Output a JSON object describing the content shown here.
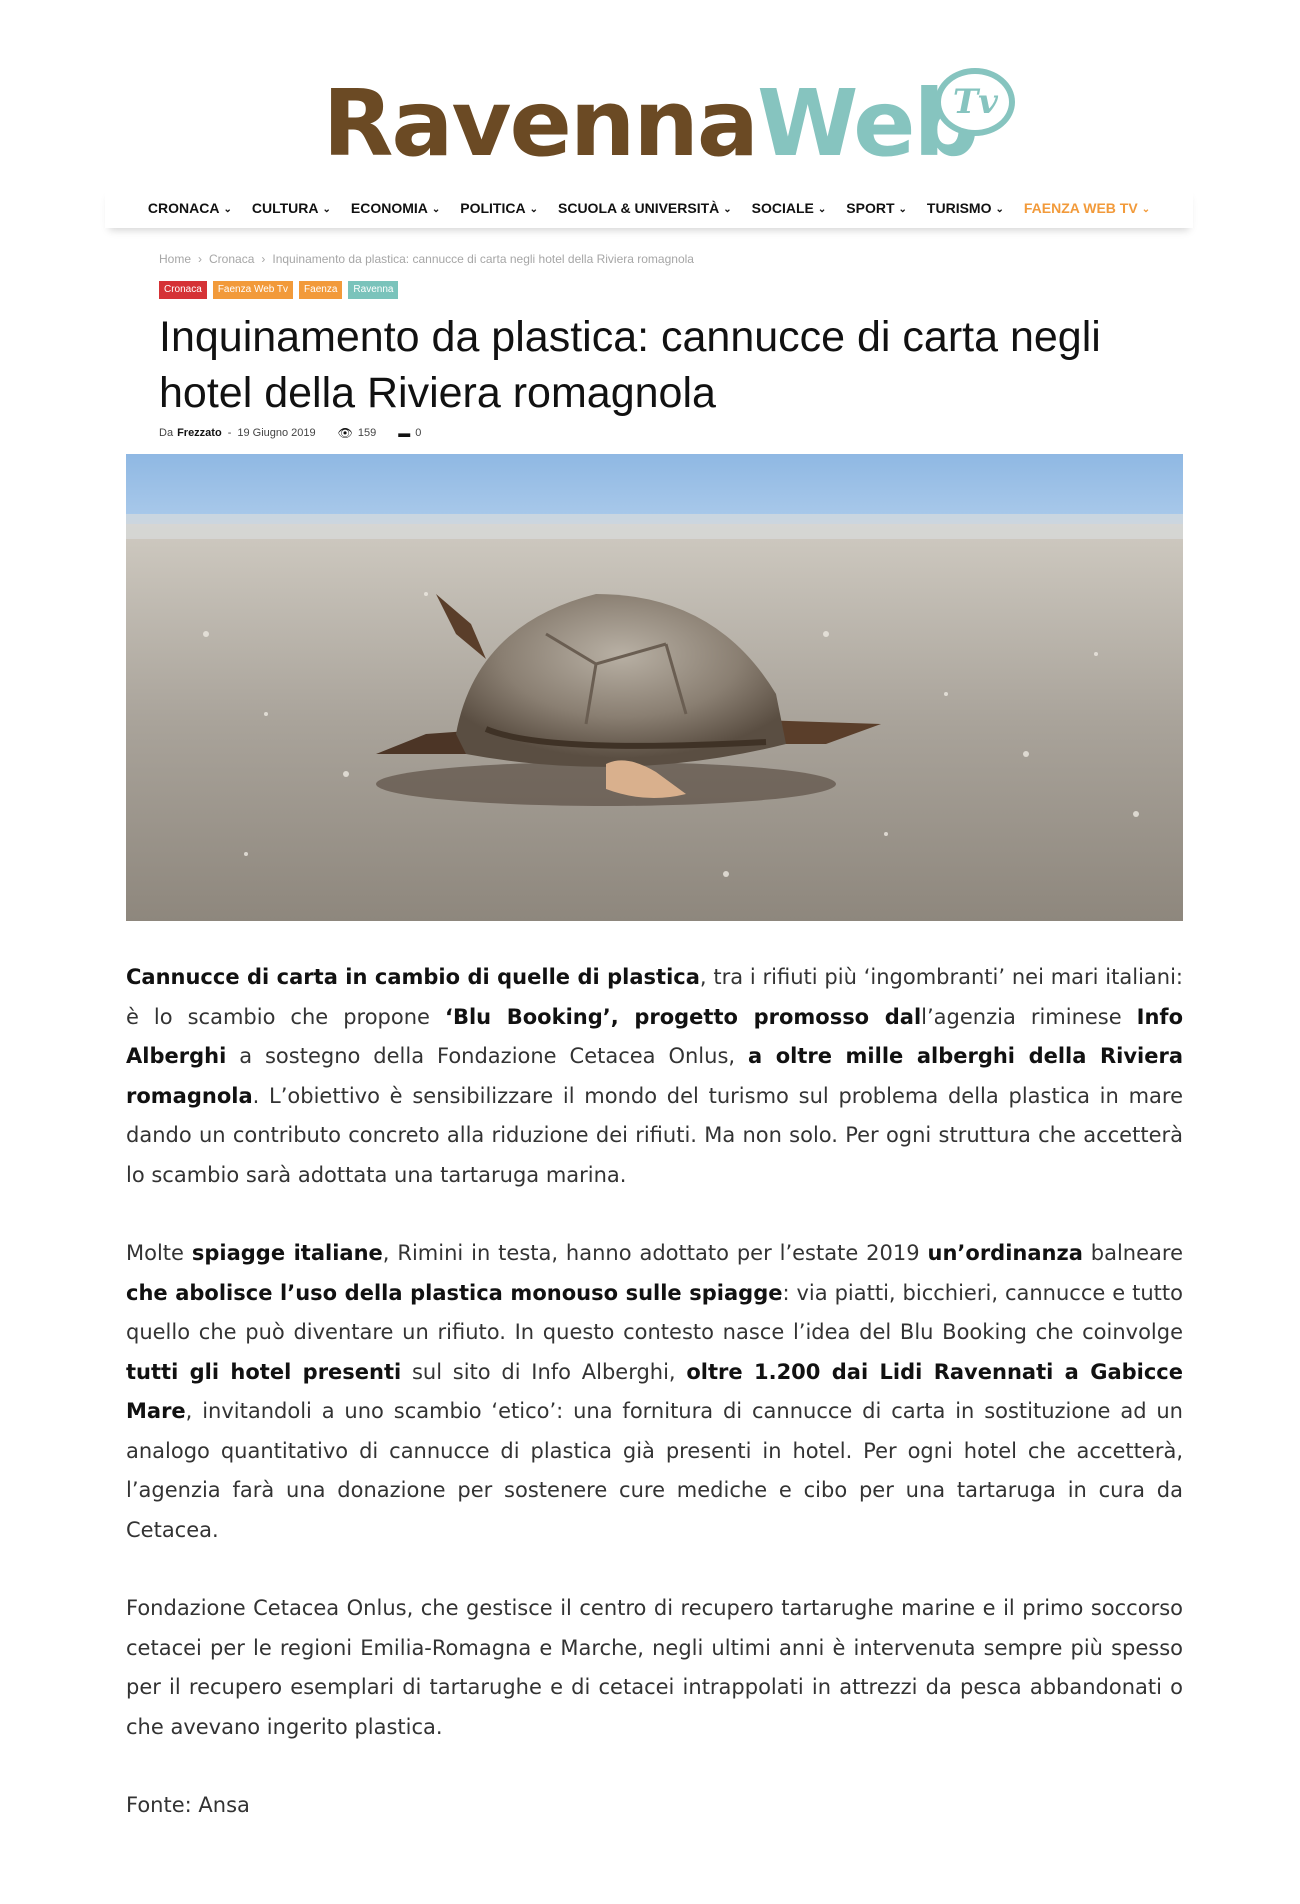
{
  "logo": {
    "part1": "Ravenna",
    "part2": "Web",
    "tv": "Tv"
  },
  "nav": [
    {
      "label": "CRONACA"
    },
    {
      "label": "CULTURA"
    },
    {
      "label": "ECONOMIA"
    },
    {
      "label": "POLITICA"
    },
    {
      "label": "SCUOLA & UNIVERSITÀ"
    },
    {
      "label": "SOCIALE"
    },
    {
      "label": "SPORT"
    },
    {
      "label": "TURISMO"
    },
    {
      "label": "FAENZA WEB TV",
      "accent": true
    }
  ],
  "breadcrumb": {
    "home": "Home",
    "section": "Cronaca",
    "current": "Inquinamento da plastica: cannucce di carta negli hotel della Riviera romagnola"
  },
  "tags": [
    {
      "label": "Cronaca",
      "color": "#d53236"
    },
    {
      "label": "Faenza Web Tv",
      "color": "#f29a3a"
    },
    {
      "label": "Faenza",
      "color": "#f29a3a"
    },
    {
      "label": "Ravenna",
      "color": "#7ac3bb"
    }
  ],
  "article": {
    "title": "Inquinamento da plastica: cannucce di carta negli hotel della Riviera romagnola",
    "author_prefix": "Da",
    "author": "Frezzato",
    "date": "19 Giugno 2019",
    "views": "159",
    "comments": "0",
    "source": "Fonte: Ansa"
  },
  "colors": {
    "brown": "#6b4a24",
    "teal": "#86c4bf",
    "orange": "#f29a3a",
    "red": "#d53236"
  }
}
